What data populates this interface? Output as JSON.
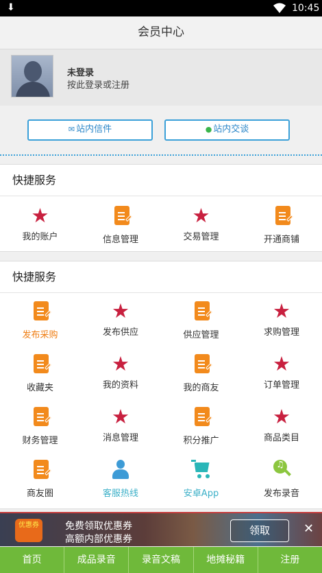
{
  "status_bar": {
    "time": "10:45"
  },
  "header": {
    "title": "会员中心"
  },
  "profile": {
    "name": "未登录",
    "hint": "按此登录或注册"
  },
  "messages": [
    {
      "label": "站内信件",
      "icon": "mail-icon"
    },
    {
      "label": "站内交谈",
      "icon": "chat-icon"
    }
  ],
  "section1": {
    "title": "快捷服务",
    "items": [
      {
        "label": "我的账户",
        "icon": "star-icon"
      },
      {
        "label": "信息管理",
        "icon": "doc-edit-icon"
      },
      {
        "label": "交易管理",
        "icon": "star-icon"
      },
      {
        "label": "开通商铺",
        "icon": "doc-edit-icon"
      }
    ]
  },
  "section2": {
    "title": "快捷服务",
    "items": [
      {
        "label": "发布采购",
        "icon": "doc-edit-icon"
      },
      {
        "label": "发布供应",
        "icon": "star-icon"
      },
      {
        "label": "供应管理",
        "icon": "doc-edit-icon"
      },
      {
        "label": "求购管理",
        "icon": "star-icon"
      },
      {
        "label": "收藏夹",
        "icon": "doc-edit-icon"
      },
      {
        "label": "我的资料",
        "icon": "star-icon"
      },
      {
        "label": "我的商友",
        "icon": "doc-edit-icon"
      },
      {
        "label": "订单管理",
        "icon": "star-icon"
      },
      {
        "label": "财务管理",
        "icon": "doc-edit-icon"
      },
      {
        "label": "消息管理",
        "icon": "star-icon"
      },
      {
        "label": "积分推广",
        "icon": "doc-edit-icon"
      },
      {
        "label": "商品类目",
        "icon": "star-icon"
      },
      {
        "label": "商友圈",
        "icon": "doc-edit-icon"
      },
      {
        "label": "客服热线",
        "icon": "person-icon"
      },
      {
        "label": "安卓App",
        "icon": "cart-icon"
      },
      {
        "label": "发布录音",
        "icon": "record-icon"
      }
    ]
  },
  "ad": {
    "logo": "优惠券",
    "line1": "免费领取优惠券",
    "line2": "高额内部优惠券",
    "button": "领取",
    "close": "✕"
  },
  "tabbar": [
    "首页",
    "成品录音",
    "录音文稿",
    "地摊秘籍",
    "注册"
  ]
}
